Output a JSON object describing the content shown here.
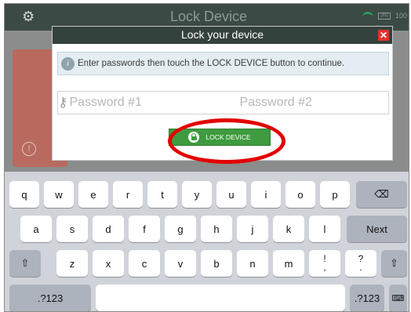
{
  "app": {
    "title": "Lock Device",
    "battery": "(III)",
    "battery_pct": "100"
  },
  "modal": {
    "title": "Lock your device",
    "info_text": "Enter passwords then touch the LOCK DEVICE button to continue.",
    "password1_placeholder": "Password #1",
    "password2_placeholder": "Password #2",
    "lock_button_label": "LOCK DEVICE"
  },
  "keyboard": {
    "row1": [
      "q",
      "w",
      "e",
      "r",
      "t",
      "y",
      "u",
      "i",
      "o",
      "p"
    ],
    "row2": [
      "a",
      "s",
      "d",
      "f",
      "g",
      "h",
      "j",
      "k",
      "l"
    ],
    "row3": [
      "z",
      "x",
      "c",
      "v",
      "b",
      "n",
      "m"
    ],
    "next_label": "Next",
    "numbers_label": ".?123",
    "numbers_label_right": ".?123",
    "excl_top": "!",
    "excl_bottom": ",",
    "quest_top": "?",
    "quest_bottom": "."
  },
  "colors": {
    "accent_green": "#3f9b3f",
    "highlight_red": "#e30000",
    "header_dark": "#34423e",
    "close_red": "#e0322b"
  }
}
